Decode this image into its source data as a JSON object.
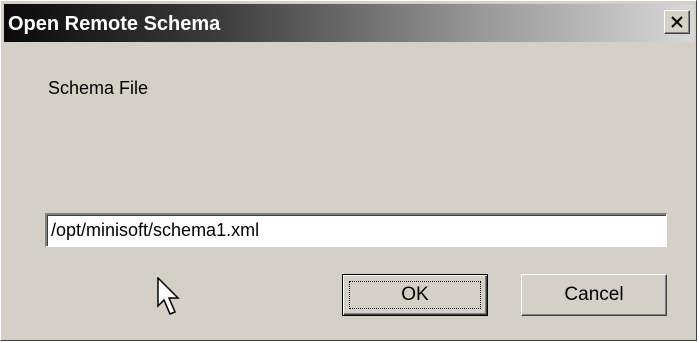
{
  "dialog": {
    "title": "Open Remote Schema",
    "close_icon": "close-icon",
    "field_label": "Schema File",
    "path_value": "/opt/minisoft/schema1.xml",
    "ok_label": "OK",
    "cancel_label": "Cancel"
  },
  "cursor": {
    "icon": "mouse-pointer-icon"
  }
}
